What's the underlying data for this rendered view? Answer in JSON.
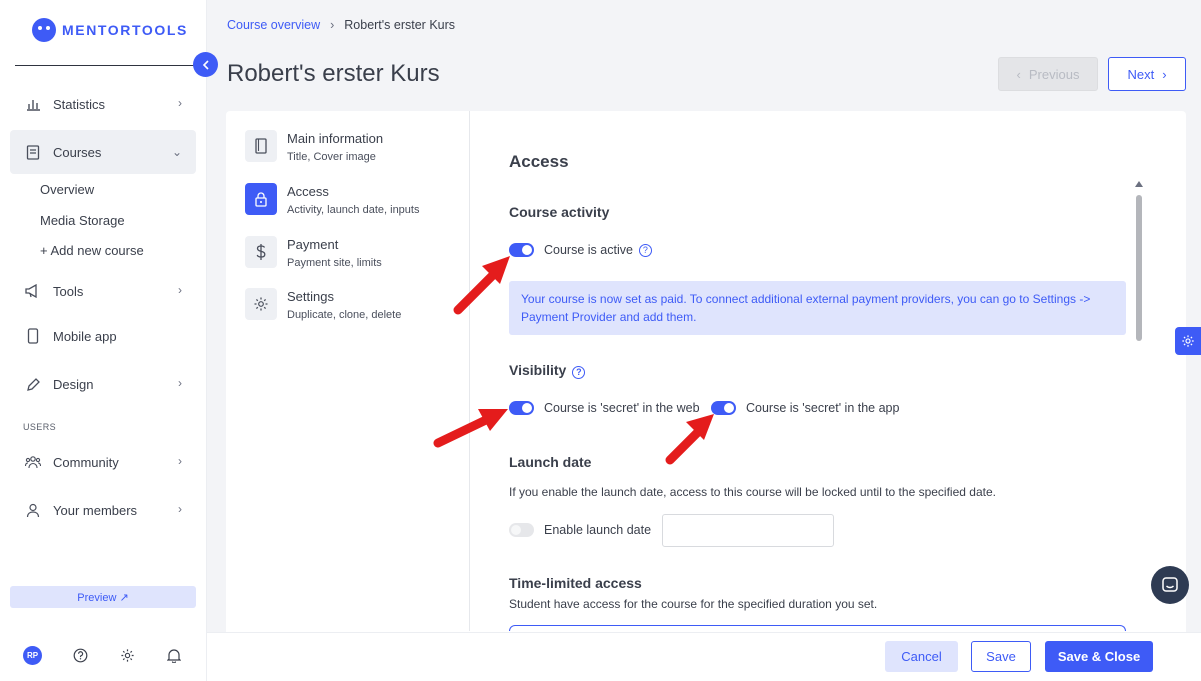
{
  "brand": {
    "name": "MENTORTOOLS"
  },
  "sidebar": {
    "items": [
      {
        "label": "Statistics",
        "icon": "bar-chart-icon"
      },
      {
        "label": "Courses",
        "icon": "book-icon"
      },
      {
        "label": "Tools",
        "icon": "megaphone-icon"
      },
      {
        "label": "Mobile app",
        "icon": "smartphone-icon"
      },
      {
        "label": "Design",
        "icon": "pencil-icon"
      },
      {
        "label": "Community",
        "icon": "users-icon"
      },
      {
        "label": "Your members",
        "icon": "user-icon"
      }
    ],
    "courses_sub": [
      "Overview",
      "Media Storage",
      "+ Add new course"
    ],
    "section_users": "USERS",
    "preview_label": "Preview ↗",
    "avatar_initials": "RP"
  },
  "header": {
    "breadcrumb_link": "Course overview",
    "breadcrumb_current": "Robert's erster Kurs",
    "title": "Robert's erster Kurs",
    "prev_label": "Previous",
    "next_label": "Next"
  },
  "steps": [
    {
      "title": "Main information",
      "subtitle": "Title, Cover image",
      "icon": "book-icon"
    },
    {
      "title": "Access",
      "subtitle": "Activity, launch date, inputs",
      "icon": "lock-icon"
    },
    {
      "title": "Payment",
      "subtitle": "Payment site, limits",
      "icon": "dollar-icon"
    },
    {
      "title": "Settings",
      "subtitle": "Duplicate, clone, delete",
      "icon": "gear-icon"
    }
  ],
  "access": {
    "title": "Access",
    "course_activity_heading": "Course activity",
    "course_active_label": "Course is active",
    "info_text": "Your course is now set as paid. To connect additional external payment providers, you can go to Settings -> Payment Provider and add them.",
    "visibility_heading": "Visibility",
    "secret_web_label": "Course is 'secret' in the web",
    "secret_app_label": "Course is 'secret' in the app",
    "launch_date_heading": "Launch date",
    "launch_date_desc": "If you enable the launch date, access to this course will be locked until to the specified date.",
    "enable_launch_label": "Enable launch date",
    "time_limited_heading": "Time-limited access",
    "time_limited_desc": "Student have access for the course for the specified duration you set."
  },
  "toggles": {
    "course_active": true,
    "secret_web": true,
    "secret_app": true,
    "launch_date": false
  },
  "footer": {
    "cancel": "Cancel",
    "save": "Save",
    "save_close": "Save & Close"
  },
  "colors": {
    "accent": "#3e5bf6",
    "info_bg": "#dfe4fd",
    "annotation_arrow": "#e41c1c"
  }
}
